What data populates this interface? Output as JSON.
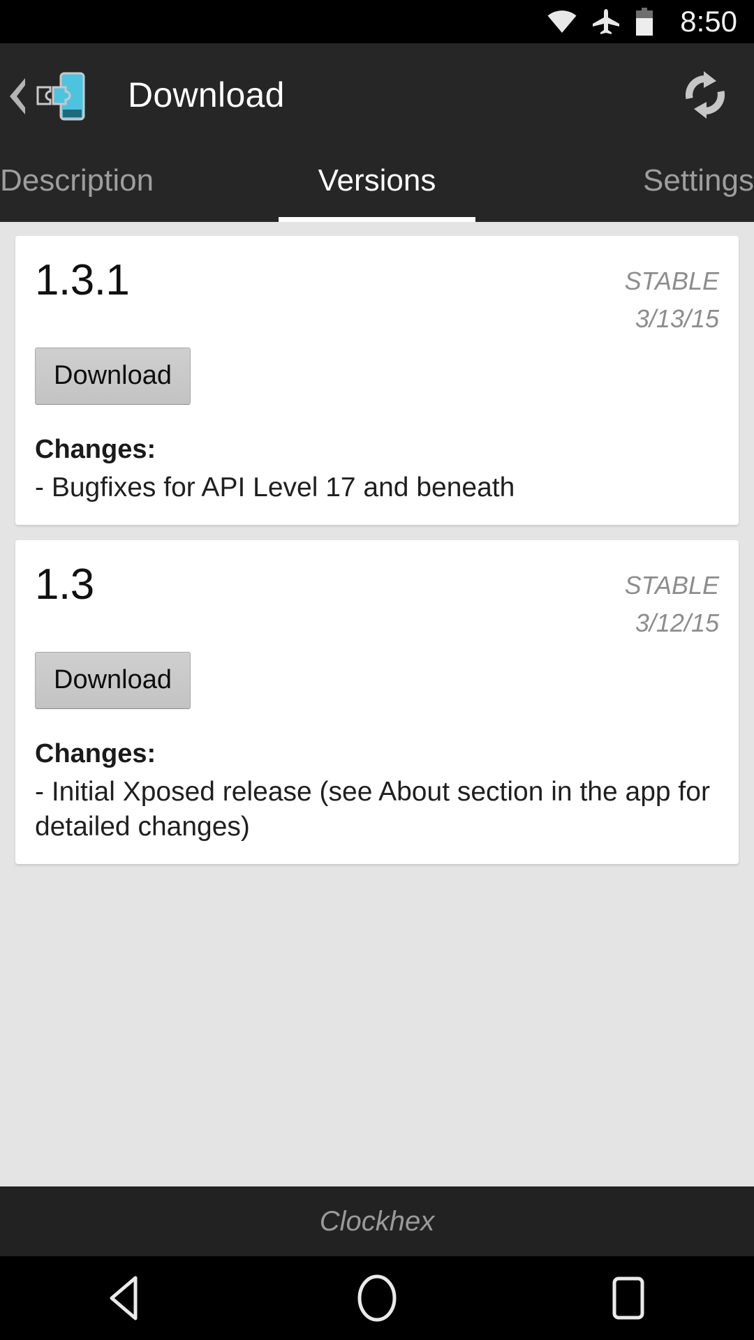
{
  "statusbar": {
    "time": "8:50",
    "icons": [
      "wifi-icon",
      "airplane-mode-icon",
      "battery-icon"
    ]
  },
  "actionbar": {
    "title": "Download",
    "up_icon": "back-chevron-icon",
    "app_icon": "xposed-puzzle-icon",
    "refresh_icon": "refresh-icon",
    "marker_icon": "resize-marker-icon",
    "accent_color": "#4ec3e0",
    "background_color": "#262626"
  },
  "tabs": {
    "items": [
      {
        "label": "Description",
        "selected": false
      },
      {
        "label": "Versions",
        "selected": true
      },
      {
        "label": "Settings",
        "selected": false
      }
    ]
  },
  "versions": [
    {
      "name": "1.3.1",
      "status": "STABLE",
      "date": "3/13/15",
      "download_label": "Download",
      "changes_label": "Changes:",
      "changes_text": "- Bugfixes for API Level 17 and beneath"
    },
    {
      "name": "1.3",
      "status": "STABLE",
      "date": "3/12/15",
      "download_label": "Download",
      "changes_label": "Changes:",
      "changes_text": "- Initial Xposed release (see About section in the app for detailed changes)"
    }
  ],
  "footer": {
    "text": "Clockhex"
  },
  "navbar": {
    "back": "back-triangle-icon",
    "home": "home-circle-icon",
    "recents": "recents-square-icon"
  }
}
